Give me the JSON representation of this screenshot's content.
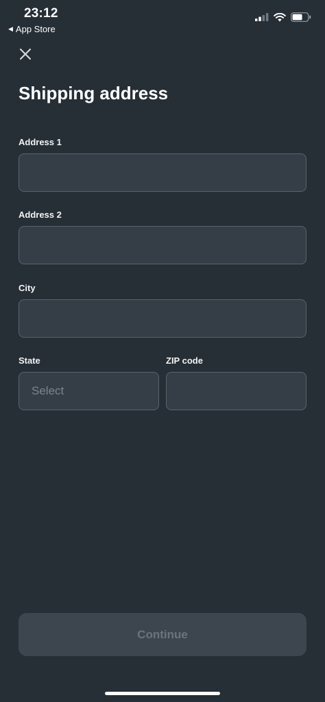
{
  "status_bar": {
    "time": "23:12",
    "back_app": "App Store",
    "back_arrow": "◀"
  },
  "title": "Shipping address",
  "form": {
    "address1": {
      "label": "Address 1",
      "value": "",
      "placeholder": ""
    },
    "address2": {
      "label": "Address 2",
      "value": "",
      "placeholder": ""
    },
    "city": {
      "label": "City",
      "value": "",
      "placeholder": ""
    },
    "state": {
      "label": "State",
      "placeholder": "Select"
    },
    "zip": {
      "label": "ZIP code",
      "value": "",
      "placeholder": ""
    }
  },
  "continue_label": "Continue",
  "icons": {
    "close": "close-icon",
    "signal": "cellular-signal-icon",
    "wifi": "wifi-icon",
    "battery": "battery-icon"
  },
  "colors": {
    "background": "#262e36",
    "input_fill": "#353e46",
    "input_border": "#5a646d",
    "button_disabled": "#3d464e",
    "button_text_disabled": "#6b747c"
  }
}
